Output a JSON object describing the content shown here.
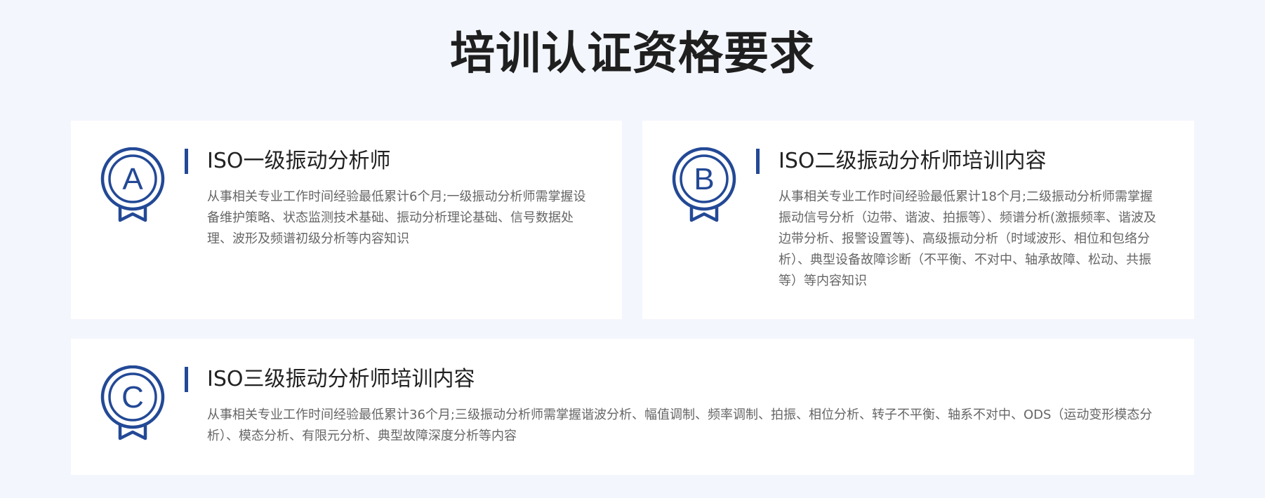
{
  "page": {
    "title": "培训认证资格要求"
  },
  "colors": {
    "background": "#f3f6fd",
    "card": "#ffffff",
    "accent": "#234996",
    "heading": "#222222",
    "body_text": "#666666"
  },
  "cards": [
    {
      "badge_letter": "A",
      "badge_icon": "award-ribbon-icon",
      "title": "ISO一级振动分析师",
      "description": "从事相关专业工作时间经验最低累计6个月;一级振动分析师需掌握设备维护策略、状态监测技术基础、振动分析理论基础、信号数据处理、波形及频谱初级分析等内容知识"
    },
    {
      "badge_letter": "B",
      "badge_icon": "award-ribbon-icon",
      "title": "ISO二级振动分析师培训内容",
      "description": "从事相关专业工作时间经验最低累计18个月;二级振动分析师需掌握振动信号分析（边带、谐波、拍振等）、频谱分析(激振频率、谐波及边带分析、报警设置等)、高级振动分析（时域波形、相位和包络分析）、典型设备故障诊断（不平衡、不对中、轴承故障、松动、共振等）等内容知识"
    },
    {
      "badge_letter": "C",
      "badge_icon": "award-ribbon-icon",
      "title": "ISO三级振动分析师培训内容",
      "description": "从事相关专业工作时间经验最低累计36个月;三级振动分析师需掌握谐波分析、幅值调制、频率调制、拍振、相位分析、转子不平衡、轴系不对中、ODS（运动变形模态分析）、模态分析、有限元分析、典型故障深度分析等内容"
    }
  ]
}
